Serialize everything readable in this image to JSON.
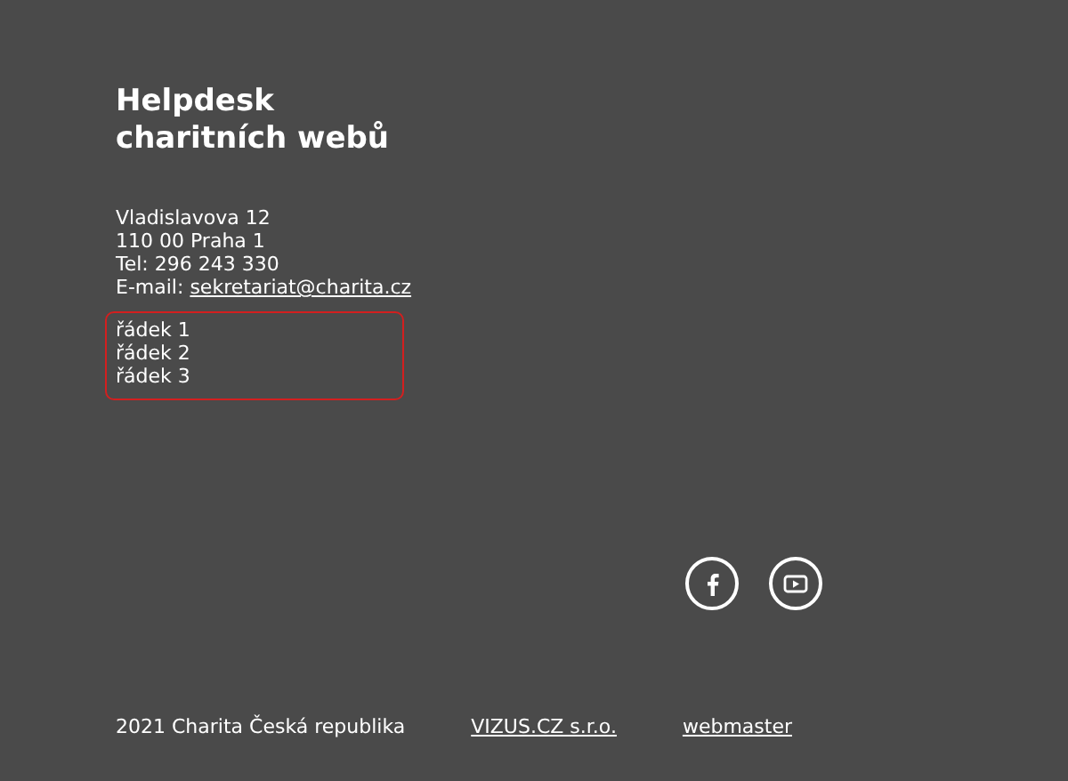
{
  "title_lines": [
    "Helpdesk",
    "charitních webů"
  ],
  "address": [
    "Vladislavova 12",
    "110 00 Praha 1",
    "Tel: 296 243 330"
  ],
  "email": {
    "label": "E-mail:",
    "link": "sekretariat@charita.cz"
  },
  "lines": [
    "řádek 1",
    "řádek 2",
    "řádek 3"
  ],
  "social": [
    {
      "kind": "facebook"
    },
    {
      "kind": "youtube"
    }
  ],
  "footer": {
    "copyright": "2021 Charita Česká republika",
    "links": [
      "VIZUS.CZ s.r.o.",
      "webmaster"
    ]
  }
}
